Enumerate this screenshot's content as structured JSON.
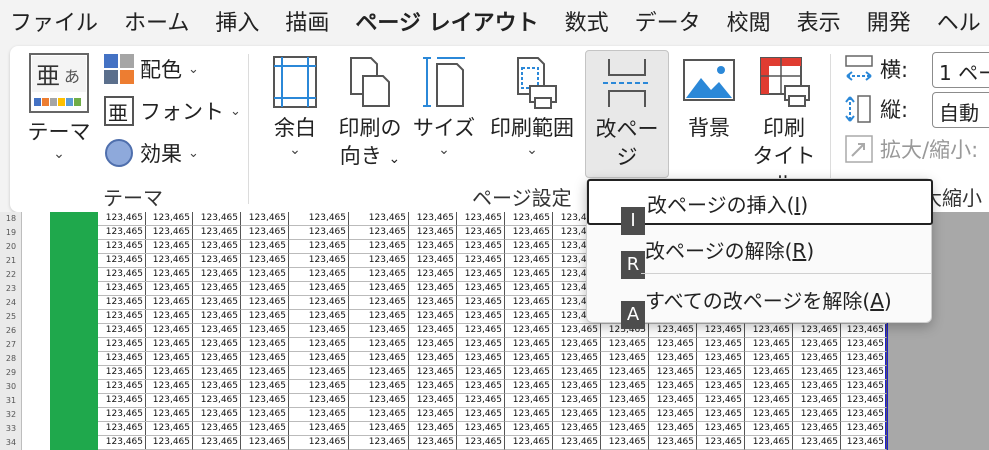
{
  "tabs": [
    "ファイル",
    "ホーム",
    "挿入",
    "描画",
    "ページ レイアウト",
    "数式",
    "データ",
    "校閲",
    "表示",
    "開発",
    "ヘル"
  ],
  "ribbon": {
    "theme_group": {
      "label": "テーマ",
      "theme_button": "テーマ",
      "colors": "配色",
      "fonts": "フォント",
      "effects": "効果"
    },
    "page_setup_group": {
      "label": "ページ設定",
      "margins": "余白",
      "orientation_1": "印刷の",
      "orientation_2": "向き",
      "size": "サイズ",
      "print_area": "印刷範囲",
      "breaks": "改ページ",
      "background": "背景",
      "print_titles_1": "印刷",
      "print_titles_2": "タイトル"
    },
    "scale_group": {
      "width_label": "横:",
      "width_value": "1 ペー",
      "height_label": "縦:",
      "height_value": "自動",
      "scale_label": "拡大/縮小:",
      "group_label": "大縮小"
    }
  },
  "menu": {
    "items": [
      {
        "key": "I",
        "text_before": "改ページの挿入(",
        "accel": "I",
        "text_after": ")"
      },
      {
        "key": "R",
        "text_before": "改ページの解除(",
        "accel": "R",
        "text_after": ")"
      },
      {
        "key": "A",
        "text_before": "すべての改ページを解除(",
        "accel": "A",
        "text_after": ")"
      }
    ]
  },
  "sheet": {
    "row_numbers": [
      "18",
      "19",
      "20",
      "21",
      "22",
      "23",
      "24",
      "25",
      "26",
      "27",
      "28",
      "29",
      "30",
      "31",
      "32",
      "33",
      "34"
    ],
    "cell_value": "123,465"
  }
}
